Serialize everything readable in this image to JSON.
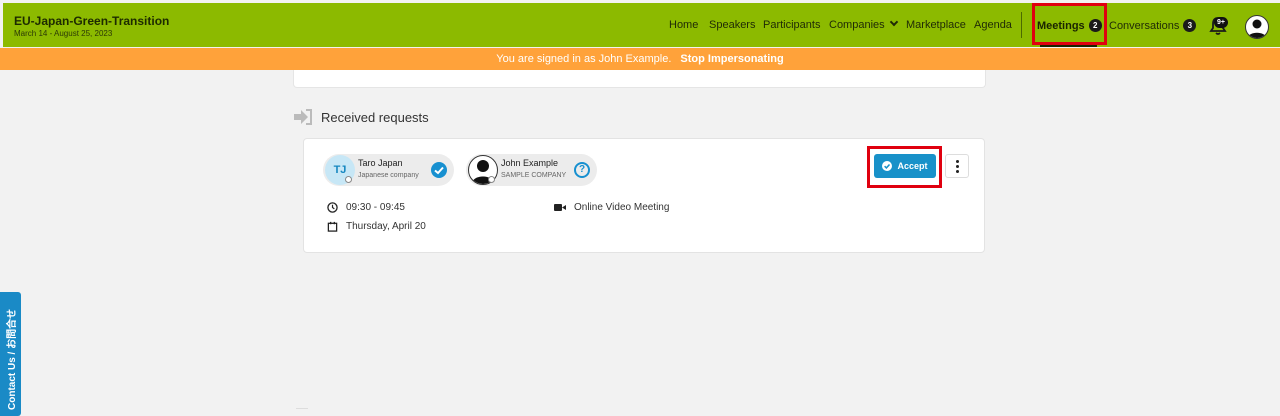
{
  "header": {
    "event_title": "EU-Japan-Green-Transition",
    "event_dates": "March 14 - August 25, 2023",
    "nav": {
      "home": "Home",
      "speakers": "Speakers",
      "participants": "Participants",
      "companies": "Companies",
      "marketplace": "Marketplace",
      "agenda": "Agenda",
      "meetings": "Meetings",
      "meetings_count": "2",
      "conversations": "Conversations",
      "conversations_count": "3"
    },
    "notifications_badge": "9+",
    "colors": {
      "topbar": "#8cba00",
      "banner": "#ffa23a",
      "accent": "#1891c9",
      "highlight": "#e0000f"
    }
  },
  "banner": {
    "text": "You are signed in as John Example.",
    "action": "Stop Impersonating"
  },
  "received": {
    "title": "Received requests",
    "request": {
      "participant_a": {
        "initials": "TJ",
        "name": "Taro Japan",
        "company": "Japanese company",
        "status": "accepted"
      },
      "participant_b": {
        "name": "John Example",
        "company": "SAMPLE COMPANY",
        "status": "pending"
      },
      "accept_label": "Accept",
      "time": "09:30 - 09:45",
      "date": "Thursday, April 20",
      "type": "Online Video Meeting"
    }
  },
  "side_tab": {
    "label": "Contact Us / お問合せ"
  }
}
